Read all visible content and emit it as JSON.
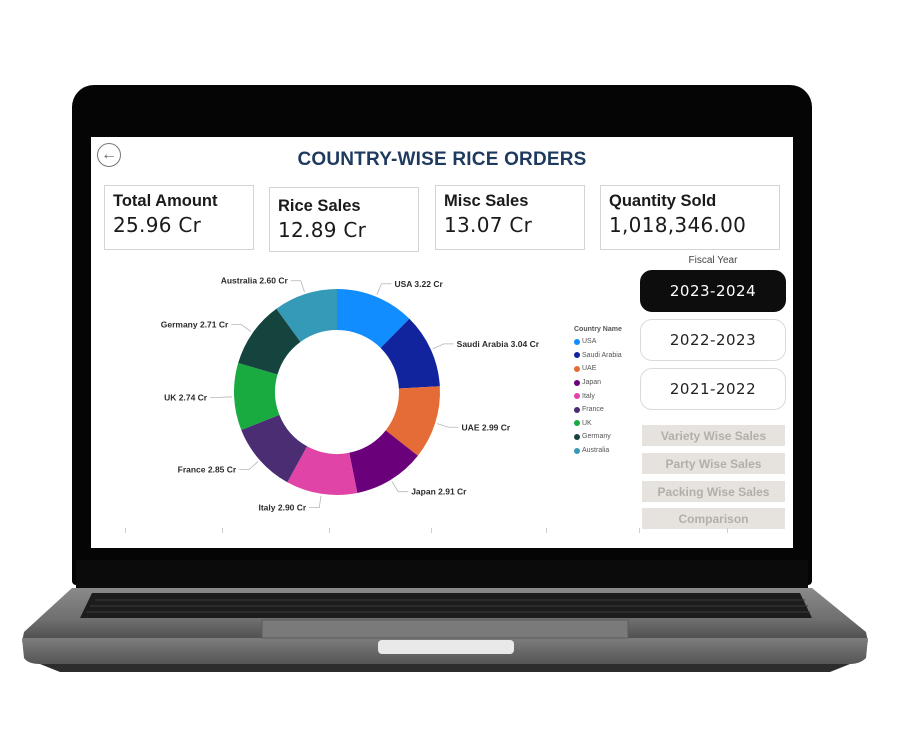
{
  "header": {
    "title": "COUNTRY-WISE RICE ORDERS",
    "back_icon": "arrow-left-circle-icon"
  },
  "kpis": [
    {
      "label": "Total Amount",
      "value": "25.96 Cr"
    },
    {
      "label": "Rice Sales",
      "value": "12.89 Cr"
    },
    {
      "label": "Misc Sales",
      "value": "13.07 Cr"
    },
    {
      "label": "Quantity Sold",
      "value": "1,018,346.00"
    }
  ],
  "fiscal_year": {
    "label": "Fiscal Year",
    "options": [
      "2023-2024",
      "2022-2023",
      "2021-2022"
    ],
    "selected": "2023-2024"
  },
  "nav_buttons": [
    "Variety Wise Sales",
    "Party Wise Sales",
    "Packing Wise Sales",
    "Comparison"
  ],
  "chart_data": {
    "type": "pie",
    "variant": "donut",
    "title": "",
    "legend_title": "Country Name",
    "legend_position": "right",
    "unit": "Cr",
    "categories": [
      "USA",
      "Saudi Arabia",
      "UAE",
      "Japan",
      "Italy",
      "France",
      "UK",
      "Germany",
      "Australia"
    ],
    "values": [
      3.22,
      3.04,
      2.99,
      2.91,
      2.9,
      2.85,
      2.74,
      2.71,
      2.6
    ],
    "labels": [
      "USA 3.22 Cr",
      "Saudi Arabia 3.04 Cr",
      "UAE 2.99 Cr",
      "Japan 2.91 Cr",
      "Italy 2.90 Cr",
      "France 2.85 Cr",
      "UK 2.74 Cr",
      "Germany 2.71 Cr",
      "Australia 2.60 Cr"
    ],
    "colors": [
      "#118dff",
      "#12239e",
      "#e66c37",
      "#6b007b",
      "#e044a7",
      "#4a2d72",
      "#1aab40",
      "#15433d",
      "#3599b8"
    ]
  }
}
